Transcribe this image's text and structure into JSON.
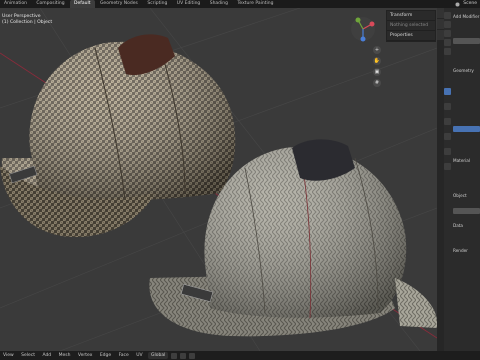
{
  "topbar": {
    "tabs": [
      "Animation",
      "Compositing",
      "Default",
      "Geometry Nodes",
      "Scripting",
      "UV Editing",
      "Shading",
      "Texture Painting"
    ],
    "active_tab": "Default",
    "scene_label": "Scene"
  },
  "viewport": {
    "info_lines": [
      "User Perspective",
      "(1) Collection | Object"
    ],
    "n_panel": [
      "Transform",
      "Nothing selected",
      "Properties"
    ],
    "nav_tools": [
      "zoom-icon",
      "hand-icon",
      "camera-icon",
      "grid-icon"
    ]
  },
  "properties_panel": {
    "rows": [
      "Add Modifier",
      "Geometry",
      "Material",
      "Object",
      "Data",
      "Render"
    ]
  },
  "header": {
    "menus": [
      "View",
      "Select",
      "Add",
      "Mesh",
      "Vertex",
      "Edge",
      "Face",
      "UV"
    ],
    "orientation": "Global",
    "pivot_icon": "pivot-icon",
    "snap_icon": "magnet-icon",
    "proportional_icon": "proportional-icon"
  },
  "colors": {
    "viewport_bg": "#3a3a3a",
    "grid_line": "#474747",
    "x_axis": "#8a2b3b",
    "accent": "#4772b3"
  }
}
